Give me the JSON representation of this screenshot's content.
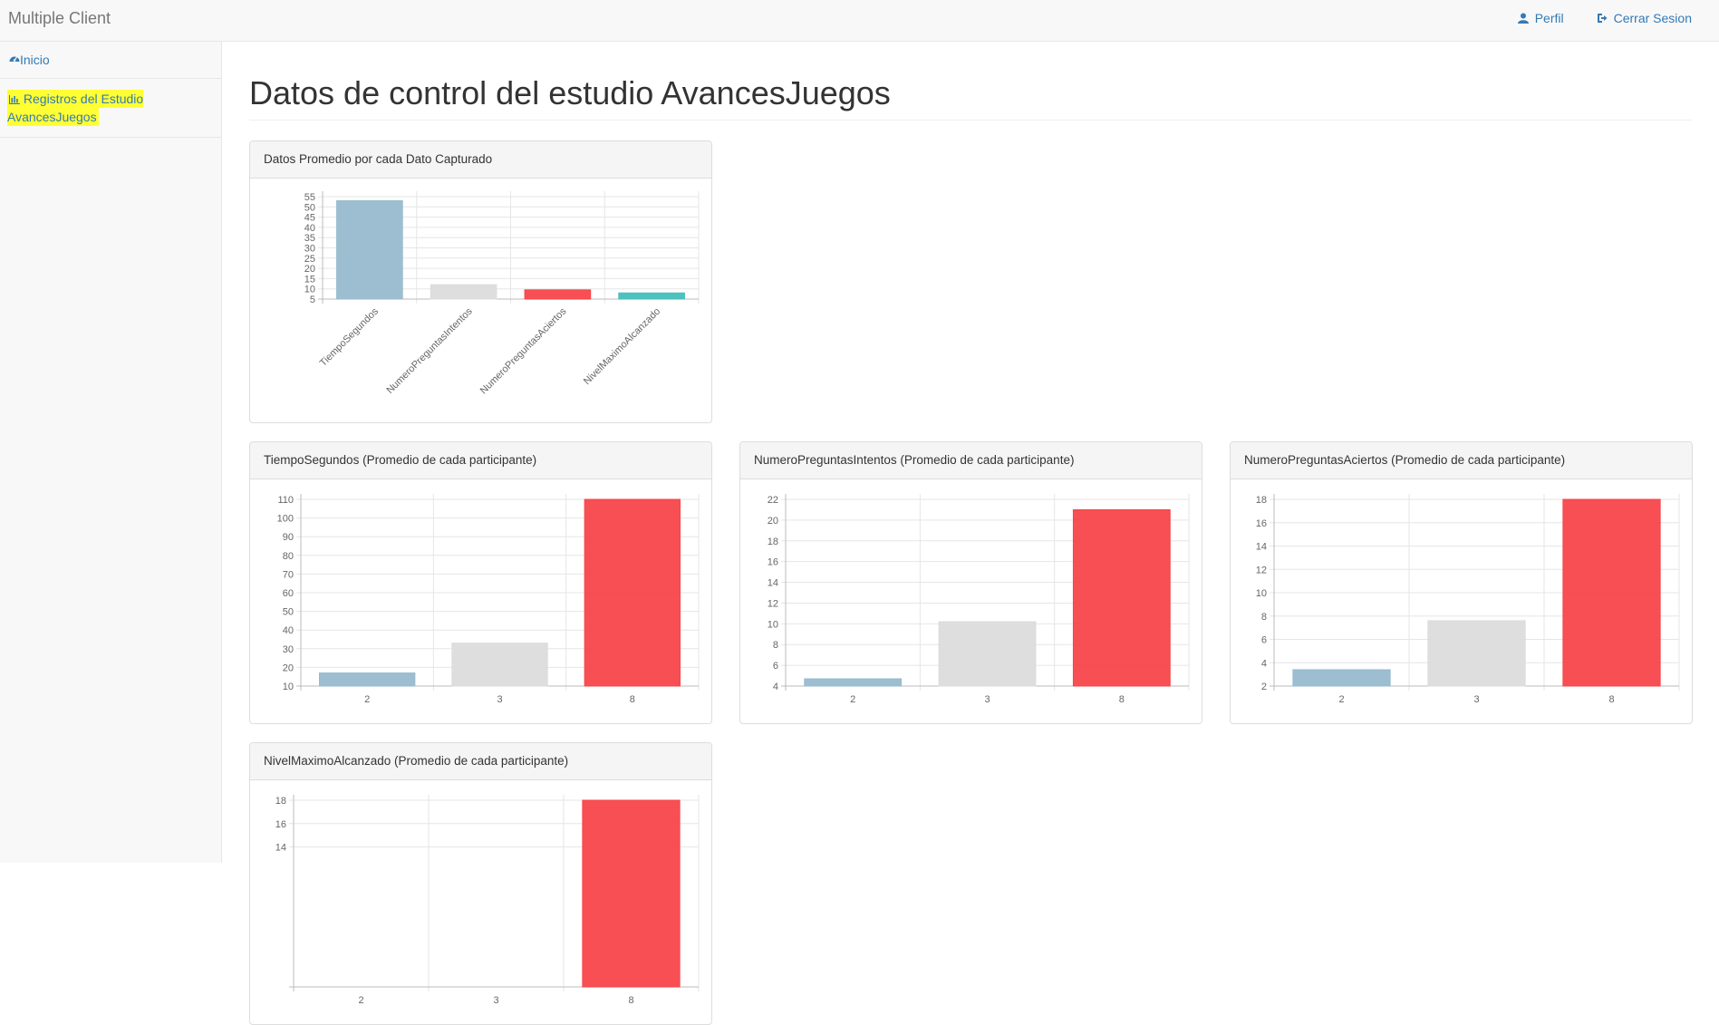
{
  "app": {
    "title": "Multiple Client"
  },
  "nav": {
    "profile": "Perfil",
    "logout": "Cerrar Sesion"
  },
  "sidebar": {
    "items": [
      {
        "label": "Inicio",
        "icon": "dashboard-icon"
      },
      {
        "label": "Registros del Estudio AvancesJuegos",
        "icon": "bar-chart-icon",
        "highlight": "#ffff33"
      }
    ]
  },
  "page": {
    "title": "Datos de control del estudio AvancesJuegos"
  },
  "colors": {
    "link": "#337ab7",
    "blue_bar": "#97bbcd",
    "gray_bar": "#dcdcdc",
    "red_bar": "#f7464a",
    "teal_bar": "#46bfbd"
  },
  "panels": [
    {
      "title": "Datos Promedio por cada Dato Capturado"
    },
    {
      "title": "TiempoSegundos (Promedio de cada participante)"
    },
    {
      "title": "NumeroPreguntasIntentos (Promedio de cada participante)"
    },
    {
      "title": "NumeroPreguntasAciertos (Promedio de cada participante)"
    },
    {
      "title": "NivelMaximoAlcanzado (Promedio de cada participante)"
    }
  ],
  "chart_data": [
    {
      "type": "bar",
      "categories": [
        "TiempoSegundos",
        "NumeroPreguntasIntentos",
        "NumeroPreguntasAciertos",
        "NivelMaximoAlcanzado"
      ],
      "values": [
        53,
        12,
        9.5,
        8
      ],
      "colors": [
        "#97bbcd",
        "#dcdcdc",
        "#f7464a",
        "#46bfbd"
      ],
      "ylim": [
        5,
        55
      ],
      "yticks": [
        5,
        10,
        15,
        20,
        25,
        30,
        35,
        40,
        45,
        50,
        55
      ],
      "grid": true
    },
    {
      "type": "bar",
      "categories": [
        "2",
        "3",
        "8"
      ],
      "values": [
        17,
        33,
        110
      ],
      "colors": [
        "#97bbcd",
        "#dcdcdc",
        "#f7464a"
      ],
      "ylim": [
        10,
        110
      ],
      "yticks": [
        10,
        20,
        30,
        40,
        50,
        60,
        70,
        80,
        90,
        100,
        110
      ],
      "grid": true
    },
    {
      "type": "bar",
      "categories": [
        "2",
        "3",
        "8"
      ],
      "values": [
        4.7,
        10.2,
        21
      ],
      "colors": [
        "#97bbcd",
        "#dcdcdc",
        "#f7464a"
      ],
      "ylim": [
        4,
        22
      ],
      "yticks": [
        4,
        6,
        8,
        10,
        12,
        14,
        16,
        18,
        20,
        22
      ],
      "grid": true
    },
    {
      "type": "bar",
      "categories": [
        "2",
        "3",
        "8"
      ],
      "values": [
        3.4,
        7.6,
        18
      ],
      "colors": [
        "#97bbcd",
        "#dcdcdc",
        "#f7464a"
      ],
      "ylim": [
        2,
        18
      ],
      "yticks": [
        2,
        4,
        6,
        8,
        10,
        12,
        14,
        16,
        18
      ],
      "grid": true
    },
    {
      "type": "bar",
      "categories": [
        "2",
        "3",
        "8"
      ],
      "values": [
        null,
        null,
        18
      ],
      "colors": [
        "#97bbcd",
        "#dcdcdc",
        "#f7464a"
      ],
      "ylim": [
        2,
        18
      ],
      "yticks": [
        14,
        16,
        18
      ],
      "grid": true
    }
  ]
}
